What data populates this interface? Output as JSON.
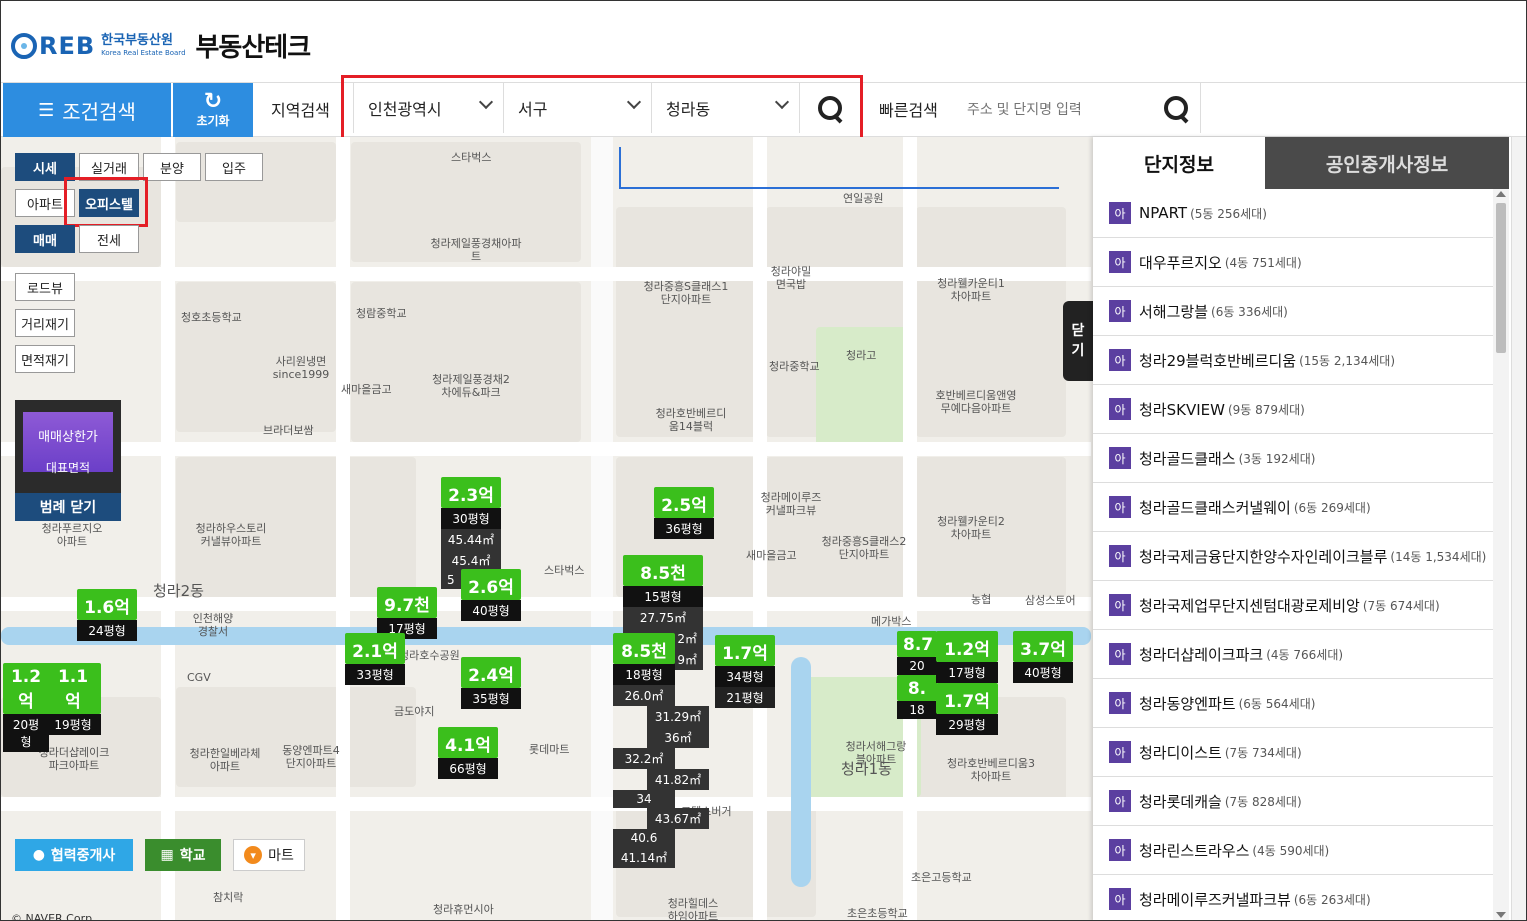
{
  "header": {
    "logo_text": "REB",
    "logo_kor": "한국부동산원",
    "logo_eng": "Korea Real Estate Board",
    "title": "부동산테크"
  },
  "searchbar": {
    "condition_search": "조건검색",
    "reset": "초기화",
    "region_label": "지역검색",
    "sido": "인천광역시",
    "sigungu": "서구",
    "dong": "청라동",
    "quick_label": "빠른검색",
    "quick_placeholder": "주소 및 단지명 입력"
  },
  "left_panel": {
    "row1": [
      "시세",
      "실거래",
      "분양",
      "입주"
    ],
    "row2": [
      "아파트",
      "오피스텔"
    ],
    "row3": [
      "매매",
      "전세"
    ],
    "tools": [
      "로드뷰",
      "거리재기",
      "면적재기"
    ],
    "legend_price": "매매상한가",
    "legend_area": "대표면적",
    "legend_close": "범례 닫기"
  },
  "map_labels": [
    "스타벅스",
    "연일공원",
    "청라제일풍경채아파트",
    "청라중흥S클래스1단지아파트",
    "청라야밀면국밥",
    "청라웰카운티1차아파트",
    "청호초등학교",
    "청람중학교",
    "사리원냉면since1999",
    "새마을금고",
    "청라제일풍경채2차에듀&파크",
    "청라호반베르디움14블럭",
    "청라중학교",
    "청라고",
    "호반베르디움앤영무예다음아파트",
    "브라더보쌈",
    "청라하우스토리커낼뷰아파트",
    "청라푸르지오아파트",
    "청라메이루즈커낼파크뷰",
    "청라중흥S클래스2단지아파트",
    "청라웰카운티2차아파트",
    "청라2동",
    "인천해양경찰서",
    "스타벅스",
    "새마을금고",
    "CGV",
    "농협",
    "삼성스토어",
    "메가박스",
    "청라호수공원",
    "금도야지",
    "롯데마트",
    "청라한일베라체아파트",
    "동양엔파트4단지아파트",
    "청라서해그랑블아파트",
    "청라1동",
    "청라호반베르디움3차아파트",
    "청라더샵레이크파크아파트",
    "고델스버거",
    "청라힐데스하임아파트",
    "청라휴먼시아",
    "참치락",
    "초은고등학교",
    "초은초등학교"
  ],
  "markers": [
    {
      "price": "2.3억",
      "size": "30평형",
      "areas": [
        "45.44㎡",
        "45.4㎡",
        "5"
      ]
    },
    {
      "price": "2.6억",
      "size": "40평형",
      "areas": []
    },
    {
      "price": "2.5억",
      "size": "36평형",
      "areas": []
    },
    {
      "price": "1.6억",
      "size": "24평형",
      "areas": []
    },
    {
      "price": "9.7천",
      "size": "17평형",
      "areas": []
    },
    {
      "price": "8.5천",
      "size": "15평형",
      "areas": [
        "27.75㎡",
        "2㎡",
        "9㎡"
      ]
    },
    {
      "price": "2.1억",
      "size": "33평형",
      "areas": []
    },
    {
      "price": "2.4억",
      "size": "35평형",
      "areas": []
    },
    {
      "price": "8.5천",
      "size": "18평형",
      "areas": [
        "26.0㎡",
        "31.29㎡",
        "36㎡",
        "32.2㎡",
        "41.82㎡",
        "34",
        "43.67㎡",
        "40.6",
        "41.14㎡"
      ]
    },
    {
      "price": "1.7억",
      "size": "34평형",
      "areas": []
    },
    {
      "price": "",
      "size": "21평형",
      "areas": []
    },
    {
      "price": "1.2억",
      "size": "20평형",
      "areas": []
    },
    {
      "price": "1.1억",
      "size": "19평형",
      "areas": []
    },
    {
      "price": "4.1억",
      "size": "66평형",
      "areas": []
    },
    {
      "price": "8.7",
      "size": "20",
      "areas": []
    },
    {
      "price": "1.2억",
      "size": "17평형",
      "areas": []
    },
    {
      "price": "1.7억",
      "size": "29평형",
      "areas": []
    },
    {
      "price": "3.7억",
      "size": "40평형",
      "areas": []
    },
    {
      "price": "8.",
      "size": "18",
      "areas": []
    }
  ],
  "bottom_buttons": {
    "agent": "협력중개사",
    "school": "학교",
    "mart": "마트"
  },
  "copyright": "© NAVER Corp.",
  "right_panel": {
    "tab_complex": "단지정보",
    "tab_agent": "공인중개사정보",
    "close": [
      "닫",
      "기"
    ],
    "tag": "아",
    "items": [
      {
        "name": "NPART",
        "meta": "(5동 256세대)"
      },
      {
        "name": "대우푸르지오",
        "meta": "(4동 751세대)"
      },
      {
        "name": "서해그랑블",
        "meta": "(6동 336세대)"
      },
      {
        "name": "청라29블럭호반베르디움",
        "meta": "(15동 2,134세대)"
      },
      {
        "name": "청라SKVIEW",
        "meta": "(9동 879세대)"
      },
      {
        "name": "청라골드클래스",
        "meta": "(3동 192세대)"
      },
      {
        "name": "청라골드클래스커낼웨이",
        "meta": "(6동 269세대)"
      },
      {
        "name": "청라국제금융단지한양수자인레이크블루",
        "meta": "(14동 1,534세대)"
      },
      {
        "name": "청라국제업무단지센텀대광로제비앙",
        "meta": "(7동 674세대)"
      },
      {
        "name": "청라더샵레이크파크",
        "meta": "(4동 766세대)"
      },
      {
        "name": "청라동양엔파트",
        "meta": "(6동 564세대)"
      },
      {
        "name": "청라디이스트",
        "meta": "(7동 734세대)"
      },
      {
        "name": "청라롯데캐슬",
        "meta": "(7동 828세대)"
      },
      {
        "name": "청라린스트라우스",
        "meta": "(4동 590세대)"
      },
      {
        "name": "청라메이루즈커낼파크뷰",
        "meta": "(6동 263세대)"
      }
    ]
  },
  "colors": {
    "accent": "#2d8de0",
    "highlight": "#e41e26",
    "marker": "#3bbf1c",
    "navy": "#1d4c7d",
    "purple": "#5b3fa0"
  }
}
